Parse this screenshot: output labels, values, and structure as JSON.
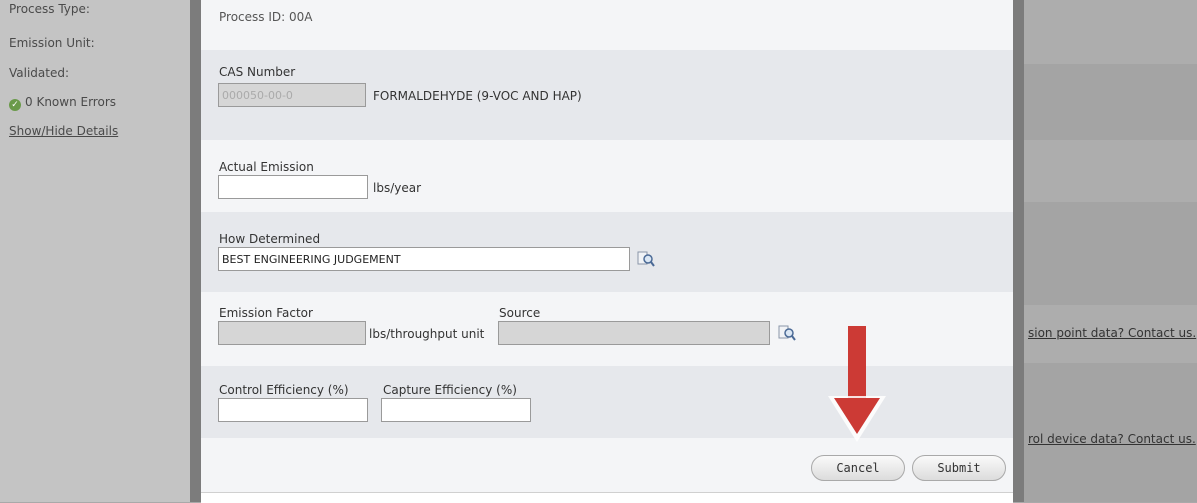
{
  "left_panel": {
    "process_type_label": "Process Type:",
    "emission_unit_label": "Emission Unit:",
    "validated_label": "Validated:",
    "known_errors": "0 Known Errors",
    "show_hide_details": "Show/Hide Details"
  },
  "right_panel": {
    "emission_point_link": "sion point data? Contact us.",
    "control_device_link": "rol device data? Contact us."
  },
  "modal": {
    "process_id": "Process ID: 00A",
    "cas_number_label": "CAS Number",
    "cas_number_value": "000050-00-0",
    "cas_name": "FORMALDEHYDE (9-VOC AND HAP)",
    "actual_emission_label": "Actual Emission",
    "actual_emission_value": "",
    "actual_emission_unit": "lbs/year",
    "how_determined_label": "How Determined",
    "how_determined_value": "BEST ENGINEERING JUDGEMENT",
    "emission_factor_label": "Emission Factor",
    "emission_factor_value": "",
    "emission_factor_unit": "lbs/throughput unit",
    "source_label": "Source",
    "source_value": "",
    "control_efficiency_label": "Control Efficiency (%)",
    "control_efficiency_value": "",
    "capture_efficiency_label": "Capture Efficiency (%)",
    "capture_efficiency_value": "",
    "cancel_label": "Cancel",
    "submit_label": "Submit"
  },
  "colors": {
    "arrow": "#cc3a35",
    "validated_ok": "#6a9a4a"
  },
  "icons": {
    "lookup": "magnifier-lookup-icon",
    "validated": "check-circle-icon",
    "pointer": "down-arrow-annotation"
  }
}
